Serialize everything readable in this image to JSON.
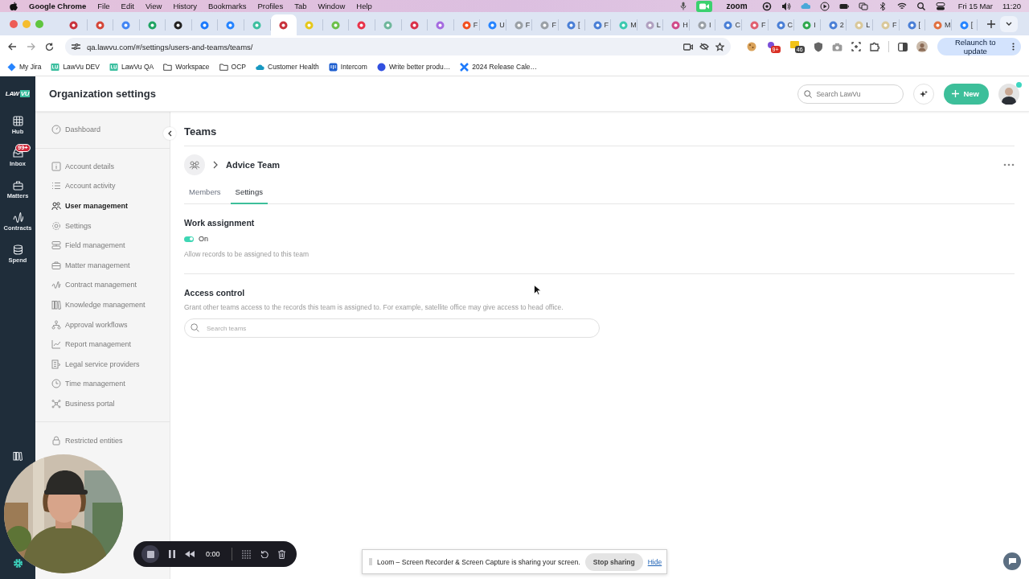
{
  "menu_bar": {
    "app_name": "Google Chrome",
    "menus": [
      "File",
      "Edit",
      "View",
      "History",
      "Bookmarks",
      "Profiles",
      "Tab",
      "Window",
      "Help"
    ],
    "zoom_label": "zoom",
    "date": "Fri 15 Mar",
    "time": "11:20"
  },
  "browser": {
    "tabs": [
      {
        "selected": false,
        "color": "#c8323c"
      },
      {
        "selected": false,
        "color": "#d44638"
      },
      {
        "selected": false,
        "color": "#4285f4"
      },
      {
        "selected": false,
        "color": "#1fa463"
      },
      {
        "selected": false,
        "color": "#222222"
      },
      {
        "selected": false,
        "color": "#1d7afc"
      },
      {
        "selected": false,
        "color": "#2684ff"
      },
      {
        "selected": false,
        "color": "#3dbfa0"
      },
      {
        "selected": true,
        "color": "#c8323c"
      },
      {
        "selected": false,
        "color": "#e6c81b"
      },
      {
        "selected": false,
        "color": "#6cc04a"
      },
      {
        "selected": false,
        "color": "#e8334a"
      },
      {
        "selected": false,
        "color": "#6fb79c"
      },
      {
        "selected": false,
        "color": "#d9304a"
      },
      {
        "selected": false,
        "color": "#a56be0"
      },
      {
        "selected": false,
        "color": "#f24e1e",
        "title": "F"
      },
      {
        "selected": false,
        "color": "#2684ff",
        "title": "U"
      },
      {
        "selected": false,
        "color": "#9aa0a6",
        "title": "F"
      },
      {
        "selected": false,
        "color": "#9aa0a6",
        "title": "F"
      },
      {
        "selected": false,
        "color": "#4a7fd6",
        "title": "["
      },
      {
        "selected": false,
        "color": "#4a7fd6",
        "title": "F"
      },
      {
        "selected": false,
        "color": "#3cc9b0",
        "title": "M"
      },
      {
        "selected": false,
        "color": "#b0a0c0",
        "title": "L"
      },
      {
        "selected": false,
        "color": "#d04a8a",
        "title": "H"
      },
      {
        "selected": false,
        "color": "#9aa0a6",
        "title": "I"
      },
      {
        "selected": false,
        "color": "#4a7fd6",
        "title": "C"
      },
      {
        "selected": false,
        "color": "#e06070",
        "title": "F"
      },
      {
        "selected": false,
        "color": "#4a7fd6",
        "title": "C"
      },
      {
        "selected": false,
        "color": "#2fa84f",
        "title": "I"
      },
      {
        "selected": false,
        "color": "#4a7fd6",
        "title": "2"
      },
      {
        "selected": false,
        "color": "#d9c89a",
        "title": "L"
      },
      {
        "selected": false,
        "color": "#d9c89a",
        "title": "F"
      },
      {
        "selected": false,
        "color": "#4a7fd6",
        "title": "["
      },
      {
        "selected": false,
        "color": "#e07040",
        "title": "M"
      },
      {
        "selected": false,
        "color": "#2684ff",
        "title": "["
      }
    ],
    "url": "qa.lawvu.com/#/settings/users-and-teams/teams/",
    "extension_badges": [
      "9+",
      "46"
    ],
    "relaunch_button": "Relaunch to update",
    "bookmarks": [
      "My Jira",
      "LawVu DEV",
      "LawVu QA",
      "Workspace",
      "OCP",
      "Customer Health",
      "Intercom",
      "Write better produ…",
      "2024 Release Cale…"
    ]
  },
  "app": {
    "logo": {
      "text": "LAW",
      "mark": "VU"
    },
    "nav": [
      {
        "label": "Hub",
        "selected": false
      },
      {
        "label": "Inbox",
        "badge": "99+",
        "selected": false
      },
      {
        "label": "Matters",
        "selected": false
      },
      {
        "label": "Contracts",
        "selected": false
      },
      {
        "label": "Spend",
        "selected": false
      }
    ],
    "header": {
      "title": "Organization settings",
      "search_placeholder": "Search LawVu",
      "new_button": "New",
      "avatar_online": true
    },
    "sidebar": {
      "top": [
        {
          "label": "Dashboard",
          "selected": false
        }
      ],
      "items": [
        {
          "label": "Account details",
          "selected": false
        },
        {
          "label": "Account activity",
          "selected": false
        },
        {
          "label": "User management",
          "selected": true
        },
        {
          "label": "Settings",
          "selected": false
        },
        {
          "label": "Field management",
          "selected": false
        },
        {
          "label": "Matter management",
          "selected": false
        },
        {
          "label": "Contract management",
          "selected": false
        },
        {
          "label": "Knowledge management",
          "selected": false
        },
        {
          "label": "Approval workflows",
          "selected": false
        },
        {
          "label": "Report management",
          "selected": false
        },
        {
          "label": "Legal service providers",
          "selected": false
        },
        {
          "label": "Time management",
          "selected": false
        },
        {
          "label": "Business portal",
          "selected": false
        }
      ],
      "bottom": [
        {
          "label": "Restricted entities",
          "selected": false
        }
      ]
    },
    "page": {
      "title": "Teams",
      "team_name": "Advice Team",
      "tabs": [
        {
          "label": "Members",
          "selected": false
        },
        {
          "label": "Settings",
          "selected": true
        }
      ],
      "work_assignment": {
        "heading": "Work assignment",
        "on": true,
        "toggle_label": "On",
        "description": "Allow records to be assigned to this team"
      },
      "access_control": {
        "heading": "Access control",
        "description": "Grant other teams access to the records this team is assigned to. For example, satellite office may give access to head office.",
        "search_placeholder": "Search teams"
      }
    }
  },
  "recorder": {
    "timer": "0:00",
    "notice": "Loom – Screen Recorder & Screen Capture is sharing your screen.",
    "stop_button": "Stop sharing",
    "hide_link": "Hide"
  }
}
